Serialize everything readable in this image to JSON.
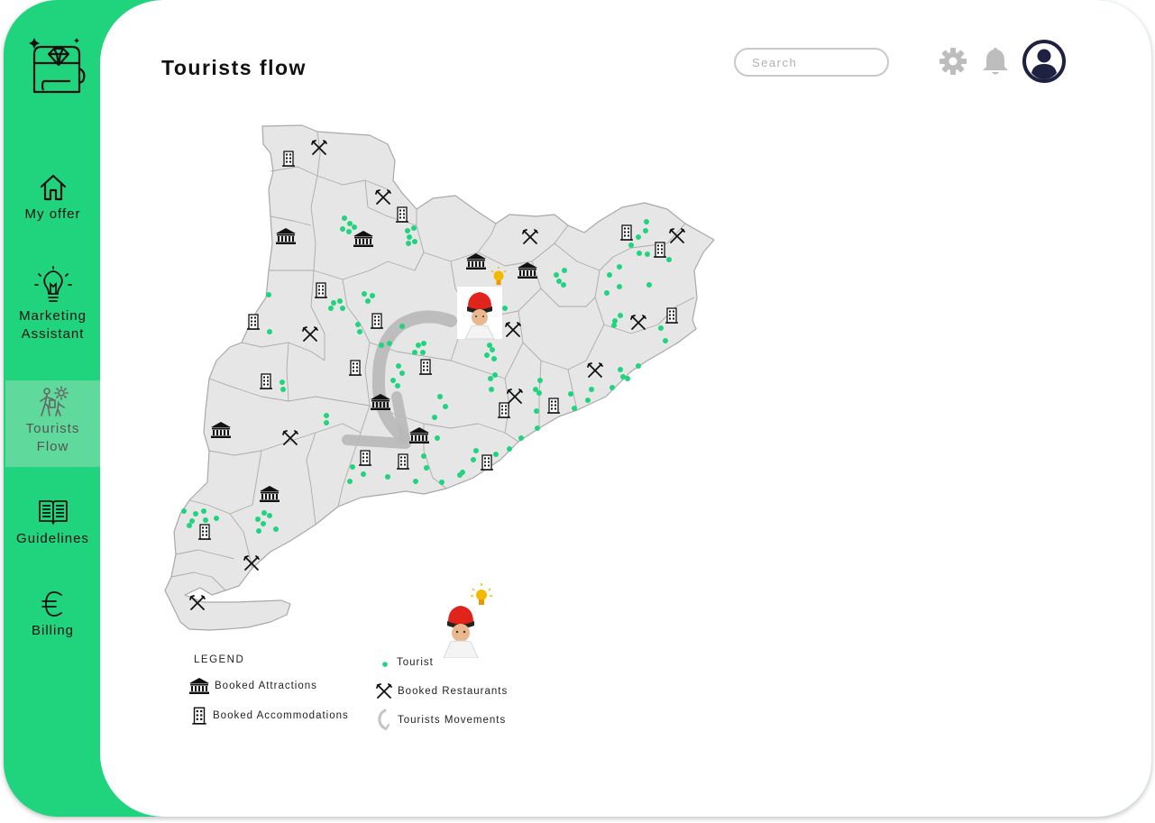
{
  "page": {
    "title": "Tourists flow"
  },
  "search": {
    "placeholder": "Search"
  },
  "header_icons": [
    "gear-icon",
    "bell-icon",
    "user-avatar-icon"
  ],
  "sidebar": {
    "items": [
      {
        "label": "My offer",
        "icon": "home-icon",
        "active": false
      },
      {
        "label": "Marketing\nAssistant",
        "icon": "lightbulb-icon",
        "active": false
      },
      {
        "label": "Tourists\nFlow",
        "icon": "tourists-icon",
        "active": true
      },
      {
        "label": "Guidelines",
        "icon": "book-icon",
        "active": false
      },
      {
        "label": "Billing",
        "icon": "euro-icon",
        "active": false
      }
    ]
  },
  "legend": {
    "title": "LEGEND",
    "attractions": "Booked Attractions",
    "accommodations": "Booked Accommodations",
    "tourist": "Tourist",
    "restaurants": "Booked Restaurants",
    "movements": "Tourists Movements"
  },
  "colors": {
    "sidebar": "#20d47e",
    "tourist_dot": "#20d47e",
    "map_fill": "#e6e6e6",
    "map_stroke": "#a8a8a8",
    "avatar": "#1e2240",
    "bulb": "#f5b800"
  }
}
